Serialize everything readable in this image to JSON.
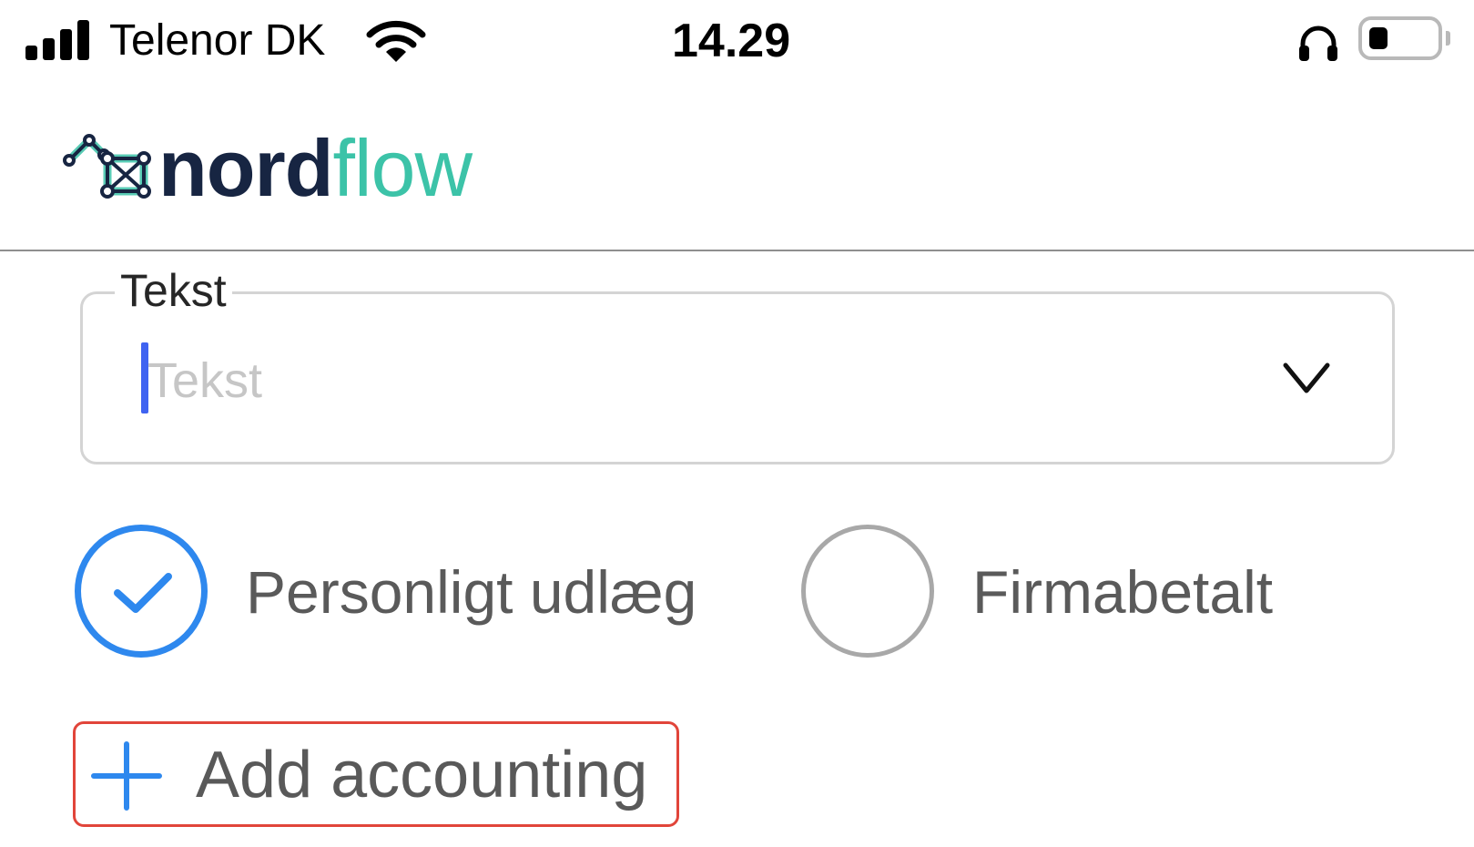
{
  "status_bar": {
    "carrier": "Telenor DK",
    "time": "14.29",
    "signal_bars": 4,
    "battery_level": 0.3,
    "icons": [
      "cellular-signal-icon",
      "wifi-icon",
      "headphones-icon",
      "battery-icon"
    ]
  },
  "header": {
    "logo_nord": "nord",
    "logo_flow": "flow",
    "colors": {
      "logo_dark": "#172542",
      "logo_teal": "#3cc3a8"
    }
  },
  "text_field": {
    "label": "Tekst",
    "value": "",
    "placeholder": "Tekst"
  },
  "payment_type": {
    "options": [
      {
        "label": "Personligt udlæg",
        "selected": true
      },
      {
        "label": "Firmabetalt",
        "selected": false
      }
    ],
    "colors": {
      "selected": "#2e88ee",
      "unselected": "#a8a8a8"
    }
  },
  "add_accounting": {
    "label": "Add accounting",
    "icon": "plus-icon",
    "highlight_color": "#e1453a"
  }
}
